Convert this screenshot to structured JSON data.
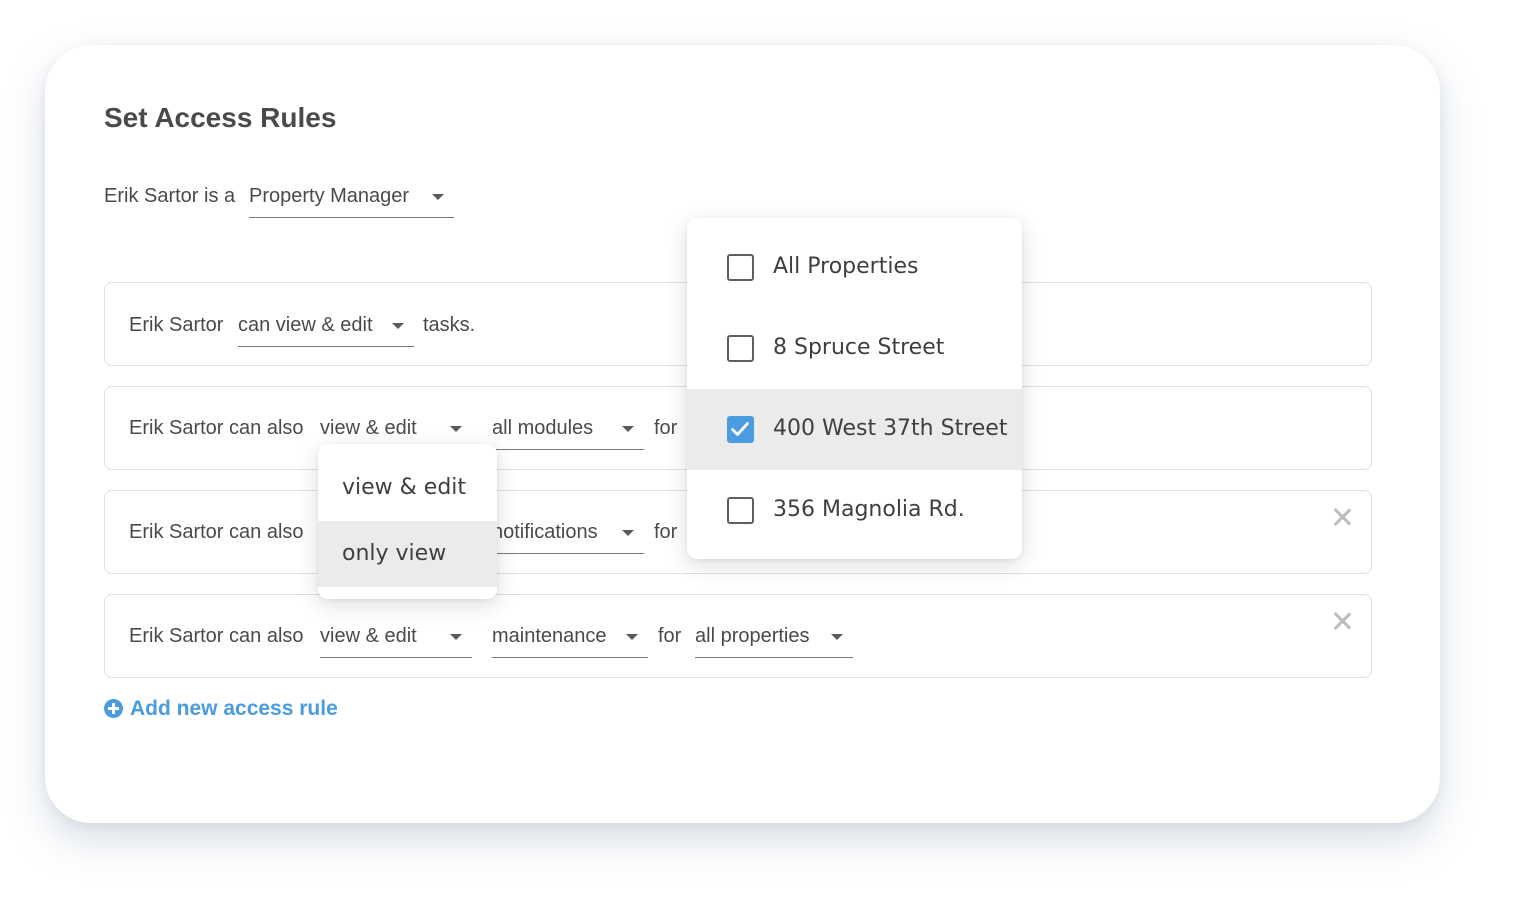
{
  "page_title": "Set Access Rules",
  "role_line": {
    "prefix": "Erik Sartor is a",
    "role": "Property Manager"
  },
  "rules": [
    {
      "prefix": "Erik Sartor",
      "access": "can view & edit",
      "suffix": "tasks."
    },
    {
      "prefix": "Erik Sartor can also",
      "access": "view & edit",
      "module": "all modules",
      "for_label": "for"
    },
    {
      "prefix": "Erik Sartor can also",
      "module": "notifications",
      "for_label": "for"
    },
    {
      "prefix": "Erik Sartor can also",
      "access": "view & edit",
      "module": "maintenance",
      "for_label": "for",
      "scope": "all properties"
    }
  ],
  "add_rule_label": "Add new access rule",
  "access_dropdown": {
    "options": [
      "view & edit",
      "only view"
    ],
    "highlighted": "only view"
  },
  "property_dropdown": {
    "options": [
      {
        "label": "All Properties",
        "checked": false
      },
      {
        "label": "8 Spruce Street",
        "checked": false
      },
      {
        "label": "400 West 37th Street",
        "checked": true
      },
      {
        "label": "356 Magnolia Rd.",
        "checked": false
      }
    ]
  },
  "colors": {
    "accent": "#4a9be0",
    "text": "#4a4a4a",
    "highlight": "#ebebeb",
    "border": "#e0e0e0"
  }
}
